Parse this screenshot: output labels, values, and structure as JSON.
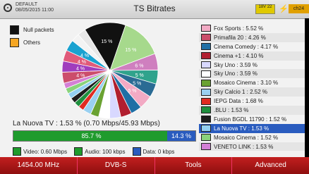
{
  "header": {
    "profile_name": "DEFAULT",
    "datetime": "08/05/2015 11:00",
    "title": "TS Bitrates",
    "voltage": "18V 22",
    "status_label": "ch24"
  },
  "legend": [
    {
      "label": "Null packets",
      "color": "#111111"
    },
    {
      "label": "Others",
      "color": "#f5a623"
    }
  ],
  "pie": {
    "slices": [
      {
        "value": 15,
        "color": "#111111",
        "label": "15 %"
      },
      {
        "value": 15,
        "color": "#a6d98c",
        "label": "15 %"
      },
      {
        "value": 6,
        "color": "#cf7fbf",
        "label": "6 %"
      },
      {
        "value": 5,
        "color": "#2fa38c",
        "label": "5 %"
      },
      {
        "value": 5,
        "color": "#2a6b94",
        "label": "5 %"
      },
      {
        "value": 5,
        "color": "#f2aac4",
        "label": "5 %"
      },
      {
        "value": 4,
        "color": "#1f6fa5",
        "label": ""
      },
      {
        "value": 4,
        "color": "#b11f2f",
        "label": ""
      },
      {
        "value": 4,
        "color": "#d8d8ff",
        "label": ""
      },
      {
        "value": 4,
        "color": "#ffffff",
        "label": ""
      },
      {
        "value": 3,
        "color": "#6aa232",
        "label": ""
      },
      {
        "value": 3,
        "color": "#9ad0f0",
        "label": ""
      },
      {
        "value": 2,
        "color": "#e02b22",
        "label": ""
      },
      {
        "value": 2,
        "color": "#1f8f3e",
        "label": ""
      },
      {
        "value": 2,
        "color": "#1d1d1d",
        "label": ""
      },
      {
        "value": 2,
        "color": "#93d0f2",
        "label": ""
      },
      {
        "value": 2,
        "color": "#8ad37b",
        "label": ""
      },
      {
        "value": 2,
        "color": "#d47fd6",
        "label": ""
      },
      {
        "value": 4,
        "color": "#cc4d6b",
        "label": "4 %"
      },
      {
        "value": 4,
        "color": "#a03dbd",
        "label": "4 %"
      },
      {
        "value": 4,
        "color": "#e05a7a",
        "label": "4 %"
      },
      {
        "value": 4,
        "color": "#1aa2d0",
        "label": "4 %"
      },
      {
        "value": 3,
        "color": "#f3f3f3",
        "label": ""
      },
      {
        "value": 3,
        "color": "#e7e7e7",
        "label": ""
      }
    ]
  },
  "detail_text": "La Nuova TV : 1.53 % (0.70 Mbps/45.93 Mbps)",
  "bar": {
    "left_label": "85.7 %",
    "right_label": "14.3 %",
    "left_fraction": 0.857
  },
  "bottom_legend": [
    {
      "label": "Video: 0.60 Mbps",
      "color": "#1f9b2d"
    },
    {
      "label": "Audio: 100 kbps",
      "color": "#1f9b2d"
    },
    {
      "label": "Data: 0 kbps",
      "color": "#2a5cbf"
    }
  ],
  "channels": [
    {
      "label": "Fox Sports : 5.52 %",
      "color": "#f2aac4"
    },
    {
      "label": "Primafila 20 : 4.26 %",
      "color": "#cc4d6b"
    },
    {
      "label": "Cinema Comedy : 4.17 %",
      "color": "#1f6fa5"
    },
    {
      "label": "Cinema +1 : 4.10 %",
      "color": "#b11f2f"
    },
    {
      "label": "Sky Uno : 3.59 %",
      "color": "#d8d8ff"
    },
    {
      "label": "Sky Uno : 3.59 %",
      "color": "#ffffff"
    },
    {
      "label": "Mosaico Cinema : 3.10 %",
      "color": "#6aa232"
    },
    {
      "label": "Sky Calcio 1 : 2.52 %",
      "color": "#9ad0f0"
    },
    {
      "label": "IEPG Data : 1.68 %",
      "color": "#e02b22"
    },
    {
      "label": ".BLU : 1.53 %",
      "color": "#1f8f3e"
    },
    {
      "label": "Fusion BGDL 11790 : 1.52 %",
      "color": "#1d1d1d"
    },
    {
      "label": "La Nuova TV : 1.53 %",
      "color": "#93d0f2",
      "selected": true
    },
    {
      "label": "Mosaico Cinema : 1.52 %",
      "color": "#8ad37b"
    },
    {
      "label": "VENETO LINK : 1.53 %",
      "color": "#d47fd6"
    }
  ],
  "softkeys": [
    "1454.00 MHz",
    "DVB-S",
    "Tools",
    "Advanced"
  ]
}
